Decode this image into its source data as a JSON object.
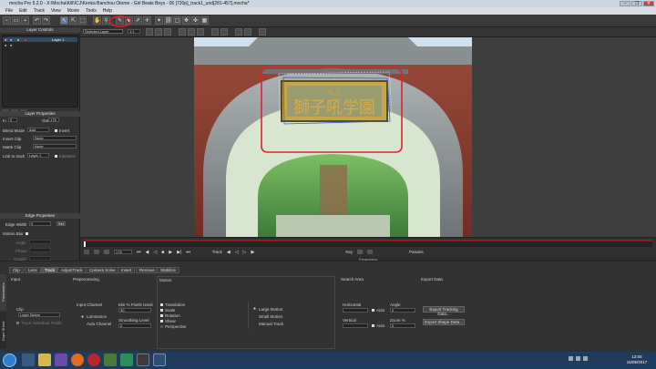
{
  "window": {
    "title": "mocha Pro 5.2.0 - X:\\Mocha\\Kill\\ICJ\\Kenka Banchou Otome - Girl Beats Boys - 06 [720p]_track1_und[281-457].mocha*",
    "controls": [
      "–",
      "❐",
      "✕"
    ]
  },
  "menu": [
    "File",
    "Edit",
    "Track",
    "View",
    "Movie",
    "Tools",
    "Help"
  ],
  "viewer_toolbar": {
    "layer_select": "Selected Layer",
    "zoom": "1:1"
  },
  "layer_controls": {
    "title": "Layer Controls",
    "layers": [
      {
        "name": "Layer 1",
        "selected": true
      }
    ]
  },
  "layer_properties": {
    "title": "Layer Properties",
    "in_label": "In",
    "in_value": "0",
    "out_label": "Out",
    "out_value": "176",
    "blend_mode_label": "Blend Mode",
    "blend_mode_value": "Add",
    "invert_label": "Invert",
    "insert_clip_label": "Insert Clip",
    "insert_clip_value": "None",
    "matte_clip_label": "Matte Clip",
    "matte_clip_value": "None",
    "link_to_track_label": "Link to track",
    "link_to_track_value": "Layer 1",
    "inherited_label": "Inherited"
  },
  "edge_properties": {
    "title": "Edge Properties",
    "edge_width_label": "Edge Width",
    "edge_width_value": "0",
    "set_label": "Set",
    "motion_blur_label": "Motion Blur",
    "angle_label": "Angle",
    "phase_label": "Phase",
    "quality_label": "Quality"
  },
  "timeline": {
    "frame_value": "176",
    "track_label": "Track",
    "key_label": "Key",
    "params_label": "Params",
    "keyframes_label": "Parameters"
  },
  "param_tabs": [
    "Clip",
    "Lens",
    "Track",
    "AdjustTrack",
    "Camera Solve",
    "Insert",
    "Remove",
    "Stabilize"
  ],
  "active_tab": "Track",
  "side_tabs": [
    "Parameters",
    "Dope Sheet"
  ],
  "track_params": {
    "input": {
      "title": "Input",
      "clip_label": "Clip",
      "clip_value": "Layer Below",
      "track_individual_label": "Track Individual Fields"
    },
    "preprocessing": {
      "title": "Preprocessing",
      "input_channel_label": "Input Channel",
      "luminance_label": "Luminance",
      "auto_channel_label": "Auto Channel",
      "min_pixels_label": "Min % Pixels Used",
      "min_pixels_value": "30",
      "smoothing_label": "Smoothing Level",
      "smoothing_value": "0"
    },
    "motion": {
      "title": "Motion",
      "options": [
        {
          "label": "Translation",
          "checked": true
        },
        {
          "label": "Scale",
          "checked": true
        },
        {
          "label": "Rotation",
          "checked": true
        },
        {
          "label": "Shear",
          "checked": true
        },
        {
          "label": "Perspective",
          "checked": false
        }
      ],
      "modes": [
        {
          "label": "Large Motion",
          "selected": true
        },
        {
          "label": "Small Motion",
          "selected": false
        },
        {
          "label": "Manual Track",
          "selected": false
        }
      ]
    },
    "search_area": {
      "title": "Search Area",
      "horizontal_label": "Horizontal",
      "vertical_label": "Vertical",
      "auto_label": "Auto",
      "angle_label": "Angle",
      "angle_value": "0",
      "zoom_label": "Zoom %",
      "zoom_value": "0"
    },
    "export": {
      "title": "Export Data",
      "tracking_button": "Export Tracking Data...",
      "shape_button": "Export Shape Data..."
    }
  },
  "scene": {
    "sign_text": "獅子吼学園",
    "sign_small": "私立"
  },
  "taskbar": {
    "time": "12:04",
    "date": "16/05/2017"
  },
  "colors": {
    "accent_red": "#d8262a",
    "spline_blue": "#2f5ecc",
    "timeline_red": "#8a1f1f"
  }
}
